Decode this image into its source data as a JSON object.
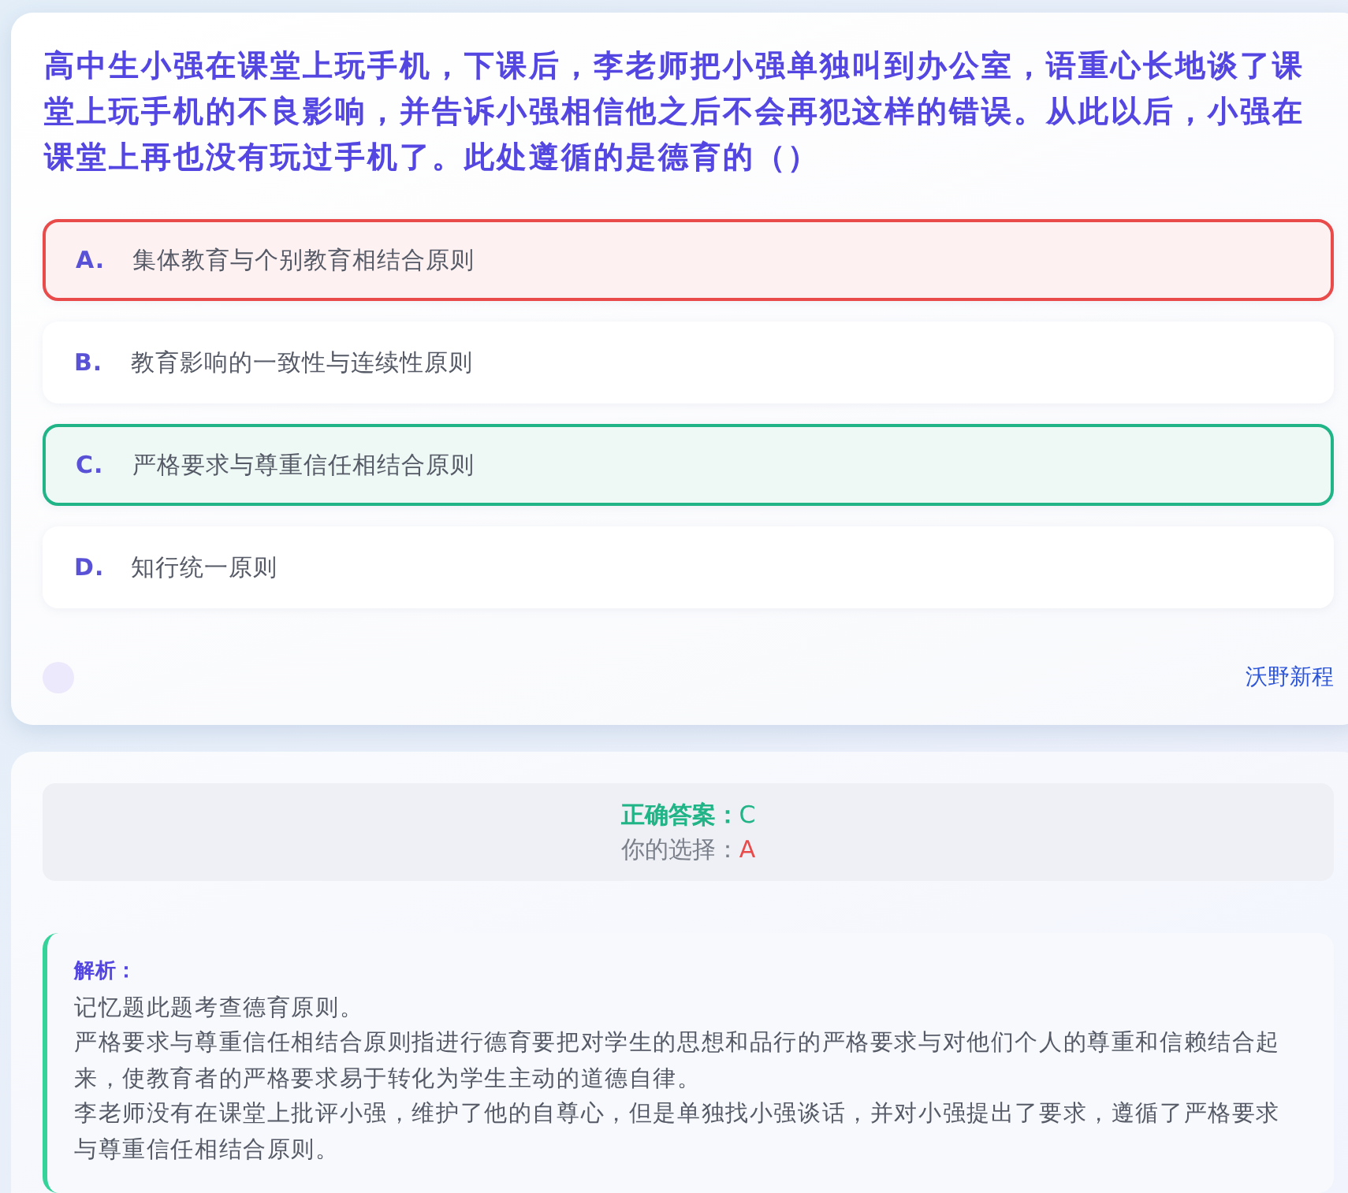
{
  "question": "高中生小强在课堂上玩手机，下课后，李老师把小强单独叫到办公室，语重心长地谈了课堂上玩手机的不良影响，并告诉小强相信他之后不会再犯这样的错误。从此以后，小强在课堂上再也没有玩过手机了。此处遵循的是德育的（）",
  "options": [
    {
      "letter": "A.",
      "text": "集体教育与个别教育相结合原则",
      "selected": true,
      "correct": false
    },
    {
      "letter": "B.",
      "text": "教育影响的一致性与连续性原则",
      "selected": false,
      "correct": false
    },
    {
      "letter": "C.",
      "text": "严格要求与尊重信任相结合原则",
      "selected": false,
      "correct": true
    },
    {
      "letter": "D.",
      "text": "知行统一原则",
      "selected": false,
      "correct": false
    }
  ],
  "footer_link": "沃野新程",
  "result": {
    "correct_label": "正确答案：",
    "correct_value": "C",
    "choice_label": "你的选择：",
    "choice_value": "A"
  },
  "analysis": {
    "title": "解析：",
    "paragraphs": [
      "记忆题此题考查德育原则。",
      "严格要求与尊重信任相结合原则指进行德育要把对学生的思想和品行的严格要求与对他们个人的尊重和信赖结合起来，使教育者的严格要求易于转化为学生主动的道德自律。",
      "李老师没有在课堂上批评小强，维护了他的自尊心，但是单独找小强谈话，并对小强提出了要求，遵循了严格要求与尊重信任相结合原则。"
    ]
  }
}
